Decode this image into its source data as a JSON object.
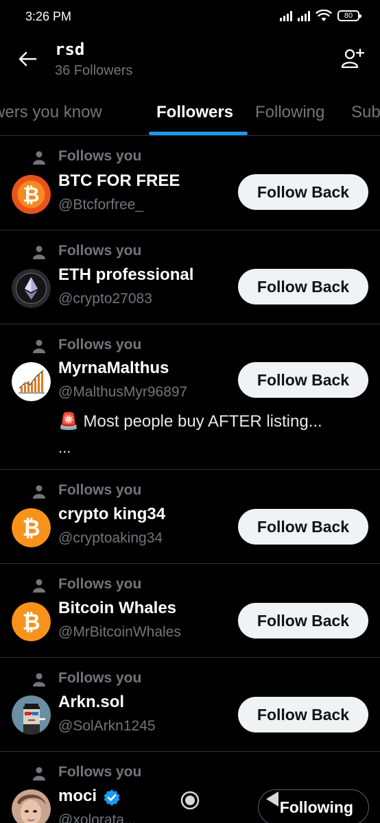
{
  "status": {
    "time": "3:26 PM",
    "battery": "80"
  },
  "header": {
    "title": "rsd",
    "subtitle": "36 Followers"
  },
  "tabs": [
    {
      "label": "Followers you know"
    },
    {
      "label": "Followers"
    },
    {
      "label": "Following"
    },
    {
      "label": "Subscriptions"
    }
  ],
  "follows_you_label": "Follows you",
  "follow_back_label": "Follow Back",
  "following_label": "Following",
  "followers": [
    {
      "name": "BTC FOR FREE",
      "handle": "@Btcforfree_",
      "avatar": "bitcoin-icon"
    },
    {
      "name": "ETH professional",
      "handle": "@crypto27083",
      "avatar": "ethereum-icon"
    },
    {
      "name": "MyrnaMalthus",
      "handle": "@MalthusMyr96897",
      "avatar": "chart-avatar",
      "bio": "🚨 Most people buy AFTER listing...",
      "bio_more": "..."
    },
    {
      "name": "crypto king34",
      "handle": "@cryptoaking34",
      "avatar": "bitcoin-icon"
    },
    {
      "name": "Bitcoin Whales",
      "handle": "@MrBitcoinWhales",
      "avatar": "bitcoin-icon"
    },
    {
      "name": "Arkn.sol",
      "handle": "@SolArkn1245",
      "avatar": "pixel-punk-avatar"
    },
    {
      "name": "moci",
      "handle": "@xolorata...",
      "avatar": "photo-avatar",
      "verified": true
    }
  ],
  "colors": {
    "accent": "#1d9bf0",
    "bitcoin": "#f7931a",
    "background": "#000000",
    "muted": "#71767b"
  }
}
